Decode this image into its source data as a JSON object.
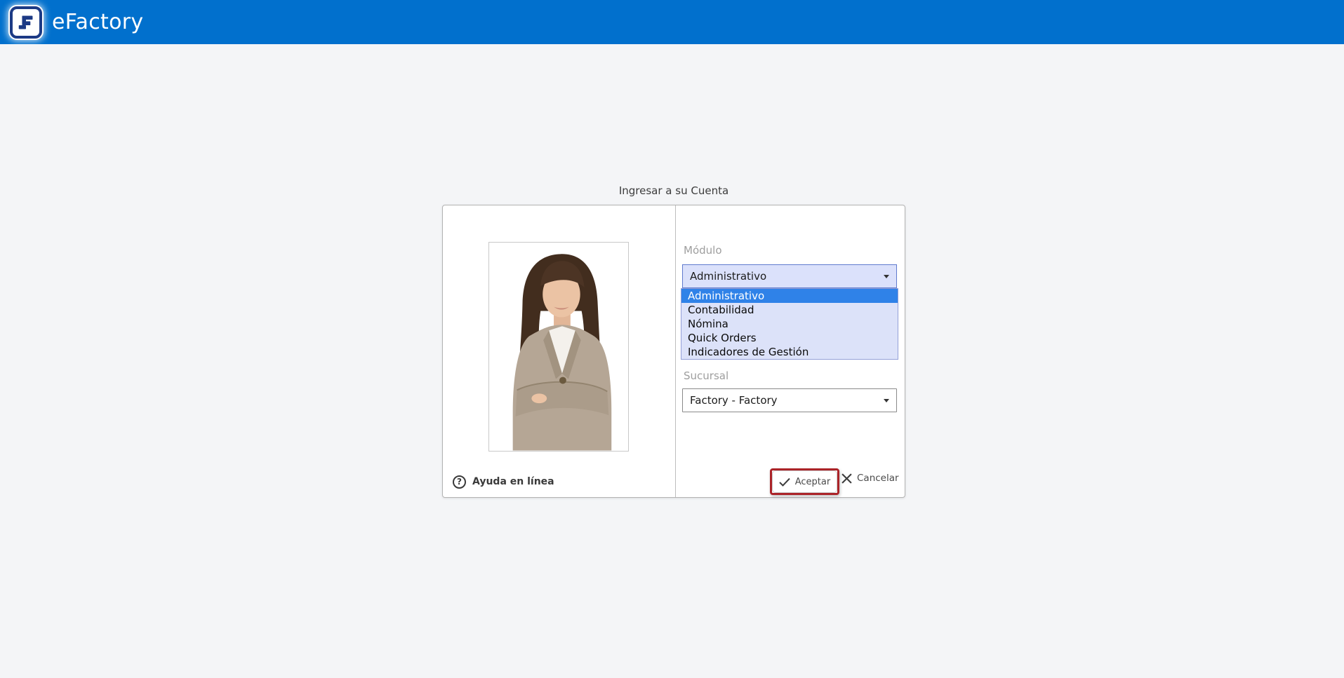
{
  "header": {
    "app_name": "eFactory",
    "colors": {
      "bar_blue": "#0170cd",
      "logo_navy": "#1c3a85"
    }
  },
  "page": {
    "title": "Ingresar a su Cuenta",
    "background": "#f4f5f7"
  },
  "login_card": {
    "left_panel": {
      "photo": "businesswoman-portrait",
      "help_link_label": "Ayuda en línea",
      "help_icon_glyph": "?"
    },
    "module_field": {
      "label": "Módulo",
      "selected_value": "Administrativo",
      "options": [
        "Administrativo",
        "Contabilidad",
        "Nómina",
        "Quick Orders",
        "Indicadores de Gestión"
      ],
      "highlighted_option": "Administrativo",
      "colors": {
        "select_fill": "#dbe1fb",
        "highlight_blue": "#2f82e8"
      }
    },
    "branch_field": {
      "label": "Sucursal",
      "selected_value": "Factory - Factory"
    },
    "actions": {
      "accept_label": "Aceptar",
      "cancel_label": "Cancelar",
      "annotation_color": "#ab2328"
    }
  }
}
